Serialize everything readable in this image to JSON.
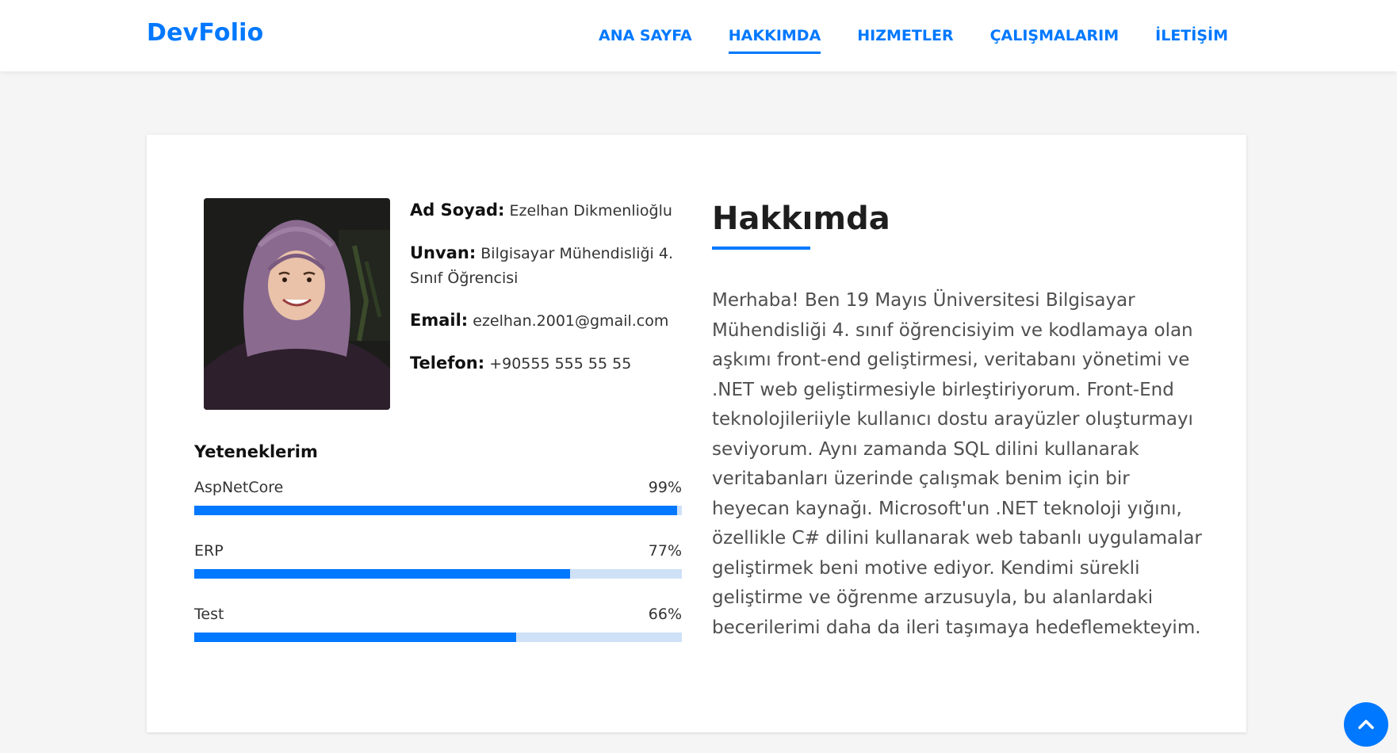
{
  "brand": "DevFolio",
  "nav": {
    "items": [
      {
        "label": "ANA SAYFA"
      },
      {
        "label": "HAKKIMDA"
      },
      {
        "label": "HIZMETLER"
      },
      {
        "label": "ÇALIŞMALARIM"
      },
      {
        "label": "İLETİŞİM"
      }
    ],
    "active": "HAKKIMDA"
  },
  "profile": {
    "photo_icon": "profile-photo",
    "fields": [
      {
        "label": "Ad Soyad:",
        "value": "Ezelhan Dikmenlioğlu"
      },
      {
        "label": "Unvan:",
        "value": "Bilgisayar Mühendisliği 4. Sınıf Öğrencisi"
      },
      {
        "label": "Email:",
        "value": "ezelhan.2001@gmail.com"
      },
      {
        "label": "Telefon:",
        "value": "+90555 555 55 55"
      }
    ]
  },
  "skills": {
    "title": "Yeteneklerim",
    "items": [
      {
        "name": "AspNetCore",
        "percent_label": "99%",
        "level": 99
      },
      {
        "name": "ERP",
        "percent_label": "77%",
        "level": 77
      },
      {
        "name": "Test",
        "percent_label": "66%",
        "level": 66
      }
    ]
  },
  "about": {
    "title": "Hakkımda",
    "text": "Merhaba! Ben 19 Mayıs Üniversitesi Bilgisayar Mühendisliği 4. sınıf öğrencisiyim ve kodlamaya olan aşkımı front-end geliştirmesi, veritabanı yönetimi ve .NET web geliştirmesiyle birleştiriyorum. Front-End teknolojileriiyle kullanıcı dostu arayüzler oluşturmayı seviyorum. Aynı zamanda SQL dilini kullanarak veritabanları üzerinde çalışmak benim için bir heyecan kaynağı. Microsoft'un .NET teknoloji yığını, özellikle C# dilini kullanarak web tabanlı uygulamalar geliştirmek beni motive ediyor. Kendimi sürekli geliştirme ve öğrenme arzusuyla, bu alanlardaki becerilerimi daha da ileri taşımaya hedeflemekteyim."
  },
  "back_to_top_icon": "chevron-up-icon",
  "colors": {
    "accent": "#0078ff",
    "track": "#cfe1f7",
    "page_bg": "#f5f5f5"
  }
}
